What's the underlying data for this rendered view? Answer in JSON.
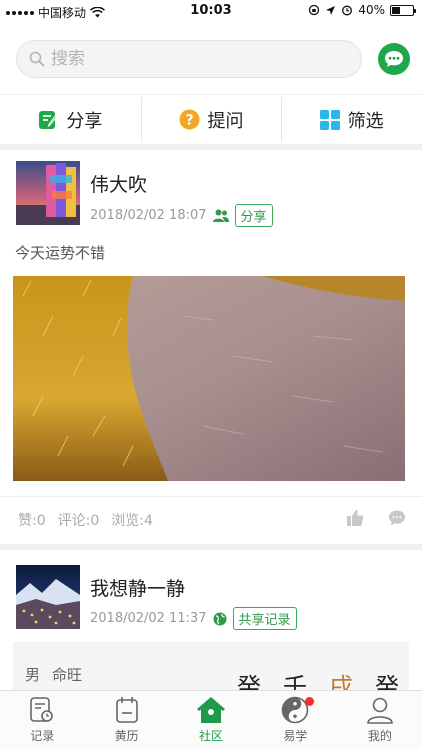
{
  "status_bar": {
    "carrier": "中国移动",
    "time": "10:03",
    "battery": "40%",
    "battery_level": 0.4
  },
  "search": {
    "placeholder": "搜索"
  },
  "actions": [
    {
      "label": "分享",
      "icon": "share-edit-icon",
      "color": "#1fa84a"
    },
    {
      "label": "提问",
      "icon": "question-icon",
      "color": "#f5a623"
    },
    {
      "label": "筛选",
      "icon": "grid-filter-icon",
      "color": "#29b6e8"
    }
  ],
  "posts": [
    {
      "author": "伟大吹",
      "datetime": "2018/02/02 18:07",
      "tag": "分享",
      "content": "今天运势不错",
      "likes_label": "赞:0",
      "comments_label": "评论:0",
      "views_label": "浏览:4"
    },
    {
      "author": "我想静一静",
      "datetime": "2018/02/02 11:37",
      "tag": "共享记录",
      "bazi": {
        "gender": "男",
        "label": "命旺",
        "chars": [
          "癸",
          "壬",
          "戌",
          "癸"
        ]
      }
    }
  ],
  "tabs": [
    {
      "label": "记录",
      "icon": "record-icon"
    },
    {
      "label": "黄历",
      "icon": "calendar-icon"
    },
    {
      "label": "社区",
      "icon": "home-icon",
      "active": true
    },
    {
      "label": "易学",
      "icon": "yinyang-icon",
      "badge": true
    },
    {
      "label": "我的",
      "icon": "profile-icon"
    }
  ],
  "colors": {
    "accent": "#1fa84a",
    "background_gap": "#efeff4"
  }
}
